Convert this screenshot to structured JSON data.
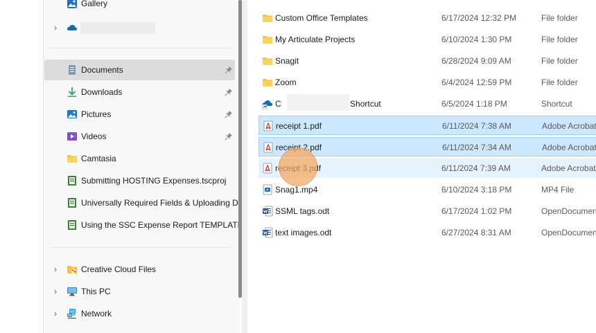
{
  "nav": {
    "gallery": {
      "label": "Gallery",
      "icon": "gallery-icon"
    },
    "onedrive": {
      "label": "",
      "icon": "cloud-icon"
    },
    "quick_access": [
      {
        "label": "Documents",
        "icon": "documents-icon",
        "pinned": true,
        "selected": true
      },
      {
        "label": "Downloads",
        "icon": "download-icon",
        "pinned": true
      },
      {
        "label": "Pictures",
        "icon": "pictures-icon",
        "pinned": true
      },
      {
        "label": "Videos",
        "icon": "videos-icon",
        "pinned": true
      },
      {
        "label": "Camtasia",
        "icon": "folder-icon",
        "pinned": false
      },
      {
        "label": "Submitting HOSTING Expenses.tscproj",
        "icon": "tscproj-file-icon",
        "pinned": false
      },
      {
        "label": "Universally Required Fields & Uploading D",
        "icon": "tscproj-file-icon",
        "pinned": false
      },
      {
        "label": "Using the SSC Expense Report TEMPLATE.t",
        "icon": "tscproj-file-icon",
        "pinned": false
      }
    ],
    "locations": [
      {
        "label": "Creative Cloud Files",
        "icon": "creative-cloud-folder-icon"
      },
      {
        "label": "This PC",
        "icon": "computer-icon"
      },
      {
        "label": "Network",
        "icon": "network-icon"
      }
    ]
  },
  "files": [
    {
      "name": "Custom Office Templates",
      "date": "6/17/2024 12:32 PM",
      "type": "File folder",
      "icon": "folder-icon"
    },
    {
      "name": "My Articulate Projects",
      "date": "6/10/2024 1:30 PM",
      "type": "File folder",
      "icon": "folder-icon"
    },
    {
      "name": "Snagit",
      "date": "6/28/2024 9:09 AM",
      "type": "File folder",
      "icon": "folder-icon"
    },
    {
      "name": "Zoom",
      "date": "6/4/2024 12:59 PM",
      "type": "File folder",
      "icon": "folder-icon"
    },
    {
      "name_prefix": "C",
      "name_suffix": "n - Shortcut",
      "date": "6/5/2024 1:18 PM",
      "type": "Shortcut",
      "icon": "onedrive-shortcut-icon"
    },
    {
      "name": "receipt 1.pdf",
      "date": "6/11/2024 7:38 AM",
      "type": "Adobe Acrobat",
      "icon": "pdf-icon",
      "state": "selected"
    },
    {
      "name": "receipt 2.pdf",
      "date": "6/11/2024 7:34 AM",
      "type": "Adobe Acrobat",
      "icon": "pdf-icon",
      "state": "selected"
    },
    {
      "name": "receipt 3.pdf",
      "date": "6/11/2024 7:39 AM",
      "type": "Adobe Acrobat",
      "icon": "pdf-icon",
      "state": "hover"
    },
    {
      "name": "Snag1.mp4",
      "date": "6/10/2024 3:18 PM",
      "type": "MP4 File",
      "icon": "video-file-icon"
    },
    {
      "name": "SSML tags.odt",
      "date": "6/17/2024 1:02 PM",
      "type": "OpenDocumen",
      "icon": "word-document-icon"
    },
    {
      "name": "text images.odt",
      "date": "6/27/2024 8:31 AM",
      "type": "OpenDocumen",
      "icon": "word-document-icon"
    }
  ],
  "colors": {
    "selected_row": "#cce8ff",
    "selected_border": "#99d1ff",
    "hover_row": "#e5f3ff",
    "nav_selected": "#dcdcdc",
    "folder": "#f5c342",
    "pdf_red": "#d2352a",
    "click_marker": "#f5a65f"
  }
}
